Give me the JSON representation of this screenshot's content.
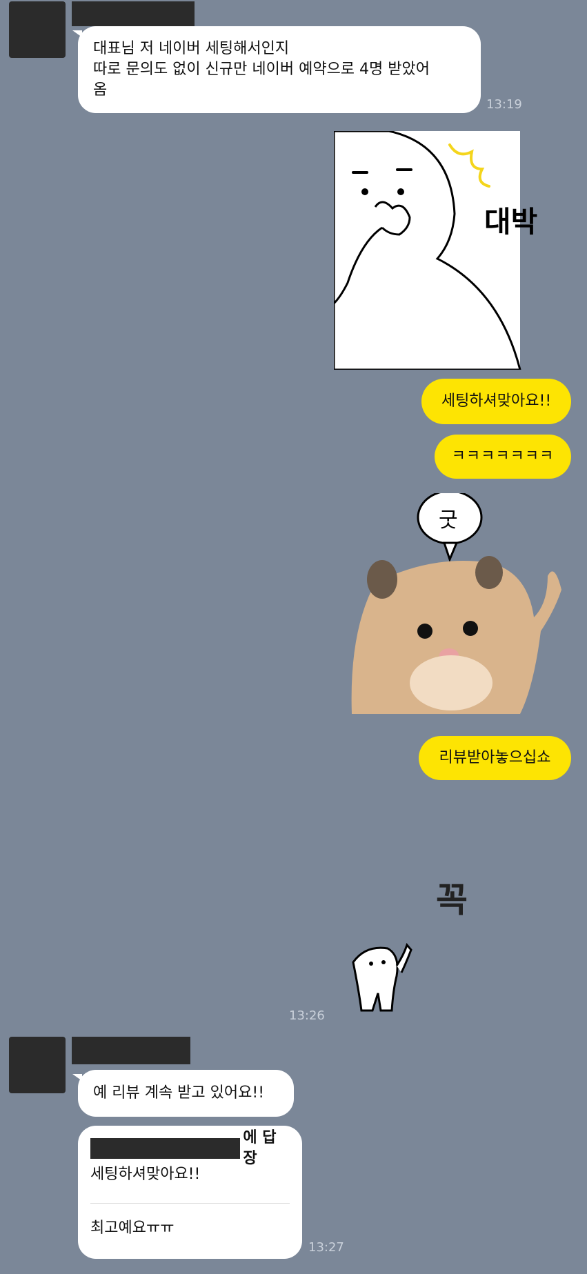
{
  "messages": [
    {
      "id": "m1",
      "from": "other",
      "text_line1": "대표님 저 네이버 세팅해서인지",
      "text_line2": "따로 문의도 없이 신규만 네이버 예약으로 4명 받았어",
      "text_line3": "옴",
      "time": "13:19"
    },
    {
      "id": "m2",
      "from": "me",
      "sticker": "surprised-character",
      "sticker_text": "대박"
    },
    {
      "id": "m3",
      "from": "me",
      "text": "세팅하셔맞아요!!"
    },
    {
      "id": "m4",
      "from": "me",
      "text": "ㅋㅋㅋㅋㅋㅋㅋ"
    },
    {
      "id": "m5",
      "from": "me",
      "sticker": "hamster-thumbs-up",
      "sticker_text": "굿"
    },
    {
      "id": "m6",
      "from": "me",
      "text": "리뷰받아놓으십쇼"
    },
    {
      "id": "m7",
      "from": "me",
      "sticker": "character-pointing",
      "sticker_text": "꼭",
      "time": "13:26"
    },
    {
      "id": "m8",
      "from": "other",
      "text": "예 리뷰 계속 받고 있어요!!"
    },
    {
      "id": "m9",
      "from": "other",
      "reply_suffix": "에 답장",
      "reply_quote": "세팅하셔맞아요!!",
      "text": "최고예요ㅠㅠ",
      "time": "13:27"
    }
  ],
  "colors": {
    "background": "#7b8798",
    "incoming_bubble": "#ffffff",
    "outgoing_bubble": "#fde403",
    "time": "#c9d0da"
  }
}
